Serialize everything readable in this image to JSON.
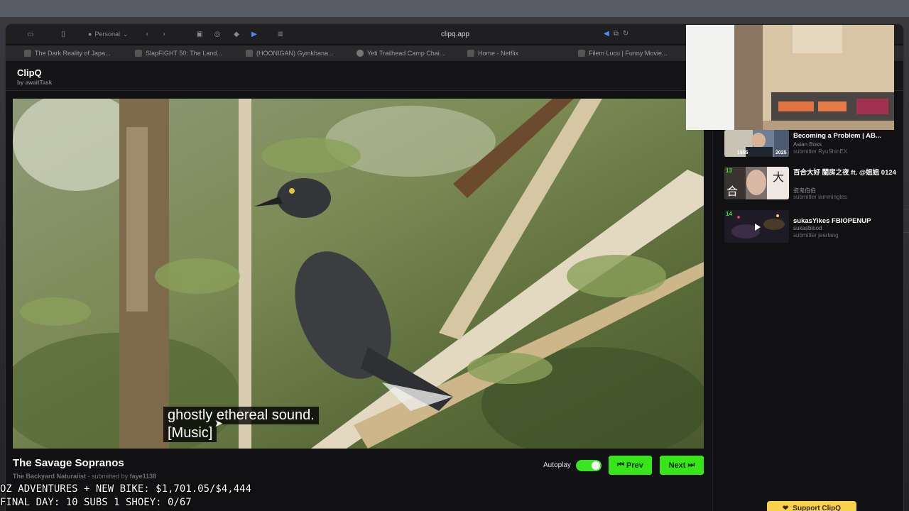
{
  "menubar": {
    "apple_icon": "apple-logo"
  },
  "browser": {
    "profile_label": "Personal",
    "url": "clipq.app",
    "tabs": [
      {
        "label": "The Dark Reality of Japa..."
      },
      {
        "label": "SlapFIGHT 50: The Land..."
      },
      {
        "label": "(HOONIGAN) Gymkhana..."
      },
      {
        "label": "Yeti Trailhead Camp Chai..."
      },
      {
        "label": "Home - Netflix"
      },
      {
        "label": "Filem Lucu | Funny Movie..."
      }
    ]
  },
  "app": {
    "logo": "ClipQ",
    "by": "by awaitTask"
  },
  "video": {
    "caption_line1": "ghostly ethereal sound.",
    "caption_line2": "[Music]",
    "title": "The Savage Sopranos",
    "channel": "The Backyard Naturalist",
    "submitted_prefix": " - submitted by ",
    "submitter": "faye1138"
  },
  "controls": {
    "autoplay_label": "Autoplay",
    "autoplay_on": true,
    "prev_label": "Prev",
    "next_label": "Next"
  },
  "queue": [
    {
      "number": "",
      "title": "Becoming a Problem | AB...",
      "channel": "Asian Boss",
      "submitter": "submitter RyuShinEX",
      "thumb_text_left": "1955",
      "thumb_text_right": "2025"
    },
    {
      "number": "13",
      "title": "百合大好 閨房之夜 ft. @姐姐 0124",
      "channel": "姿鬼伯伯",
      "submitter": "submitter iammingles"
    },
    {
      "number": "14",
      "title": "sukasYikes FBIOPENUP",
      "channel": "sukasblood",
      "submitter": "submitter jeerlang"
    }
  ],
  "support": {
    "label": "Support ClipQ"
  },
  "stream_overlay": {
    "line1": "OZ ADVENTURES + NEW BIKE: $1,701.05/$4,444",
    "line2": "FINAL DAY: 10 SUBS 1 SHOEY: 0/67"
  },
  "colors": {
    "accent_green": "#36e619",
    "background": "#111113",
    "support_yellow": "#f7d24a"
  }
}
